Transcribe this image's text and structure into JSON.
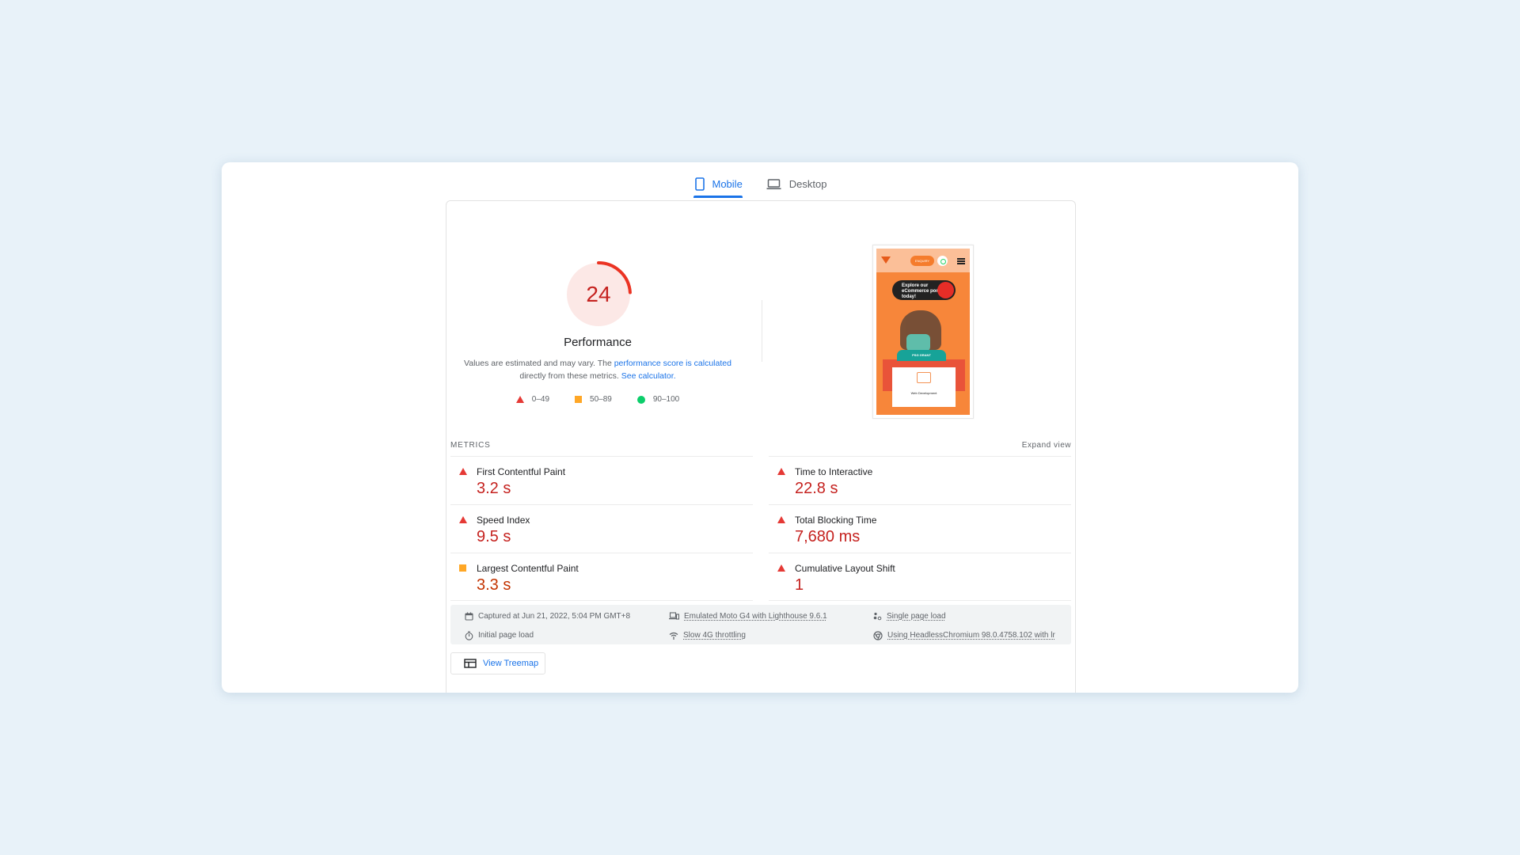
{
  "tabs": [
    {
      "label": "Mobile",
      "icon": "smartphone-icon",
      "active": true
    },
    {
      "label": "Desktop",
      "icon": "laptop-icon",
      "active": false
    }
  ],
  "score": {
    "value": 24,
    "fraction": 0.24,
    "category": "Performance",
    "color": "#eb3323",
    "bg_color": "#fce8e6",
    "text_color": "#c5221f"
  },
  "description": {
    "prefix": "Values are estimated and may vary. The ",
    "link1": "performance score is calculated",
    "middle": "directly from these metrics. ",
    "link2": "See calculator."
  },
  "legend": [
    {
      "shape": "triangle",
      "range": "0–49",
      "color": "#e53935"
    },
    {
      "shape": "square",
      "range": "50–89",
      "color": "#ffa726"
    },
    {
      "shape": "circle",
      "range": "90–100",
      "color": "#0cce6b"
    }
  ],
  "screenshot": {
    "enquiry": "ENQUIRY",
    "banner": "Explore our eCommerce portal today!",
    "badge": "PSG GRANT",
    "card_label": "Web Development"
  },
  "metrics_header": "METRICS",
  "expand_view": "Expand view",
  "metrics": [
    {
      "title": "First Contentful Paint",
      "value": "3.2 s",
      "rating": "fail"
    },
    {
      "title": "Time to Interactive",
      "value": "22.8 s",
      "rating": "fail"
    },
    {
      "title": "Speed Index",
      "value": "9.5 s",
      "rating": "fail"
    },
    {
      "title": "Total Blocking Time",
      "value": "7,680 ms",
      "rating": "fail"
    },
    {
      "title": "Largest Contentful Paint",
      "value": "3.3 s",
      "rating": "average"
    },
    {
      "title": "Cumulative Layout Shift",
      "value": "1",
      "rating": "fail"
    }
  ],
  "runtime": {
    "captured": "Captured at Jun 21, 2022, 5:04 PM GMT+8",
    "device": "Emulated Moto G4 with Lighthouse 9.6.1",
    "page_load": "Single page load",
    "initial": "Initial page load",
    "throttling": "Slow 4G throttling",
    "browser": "Using HeadlessChromium 98.0.4758.102 with lr"
  },
  "treemap_button": "View Treemap"
}
